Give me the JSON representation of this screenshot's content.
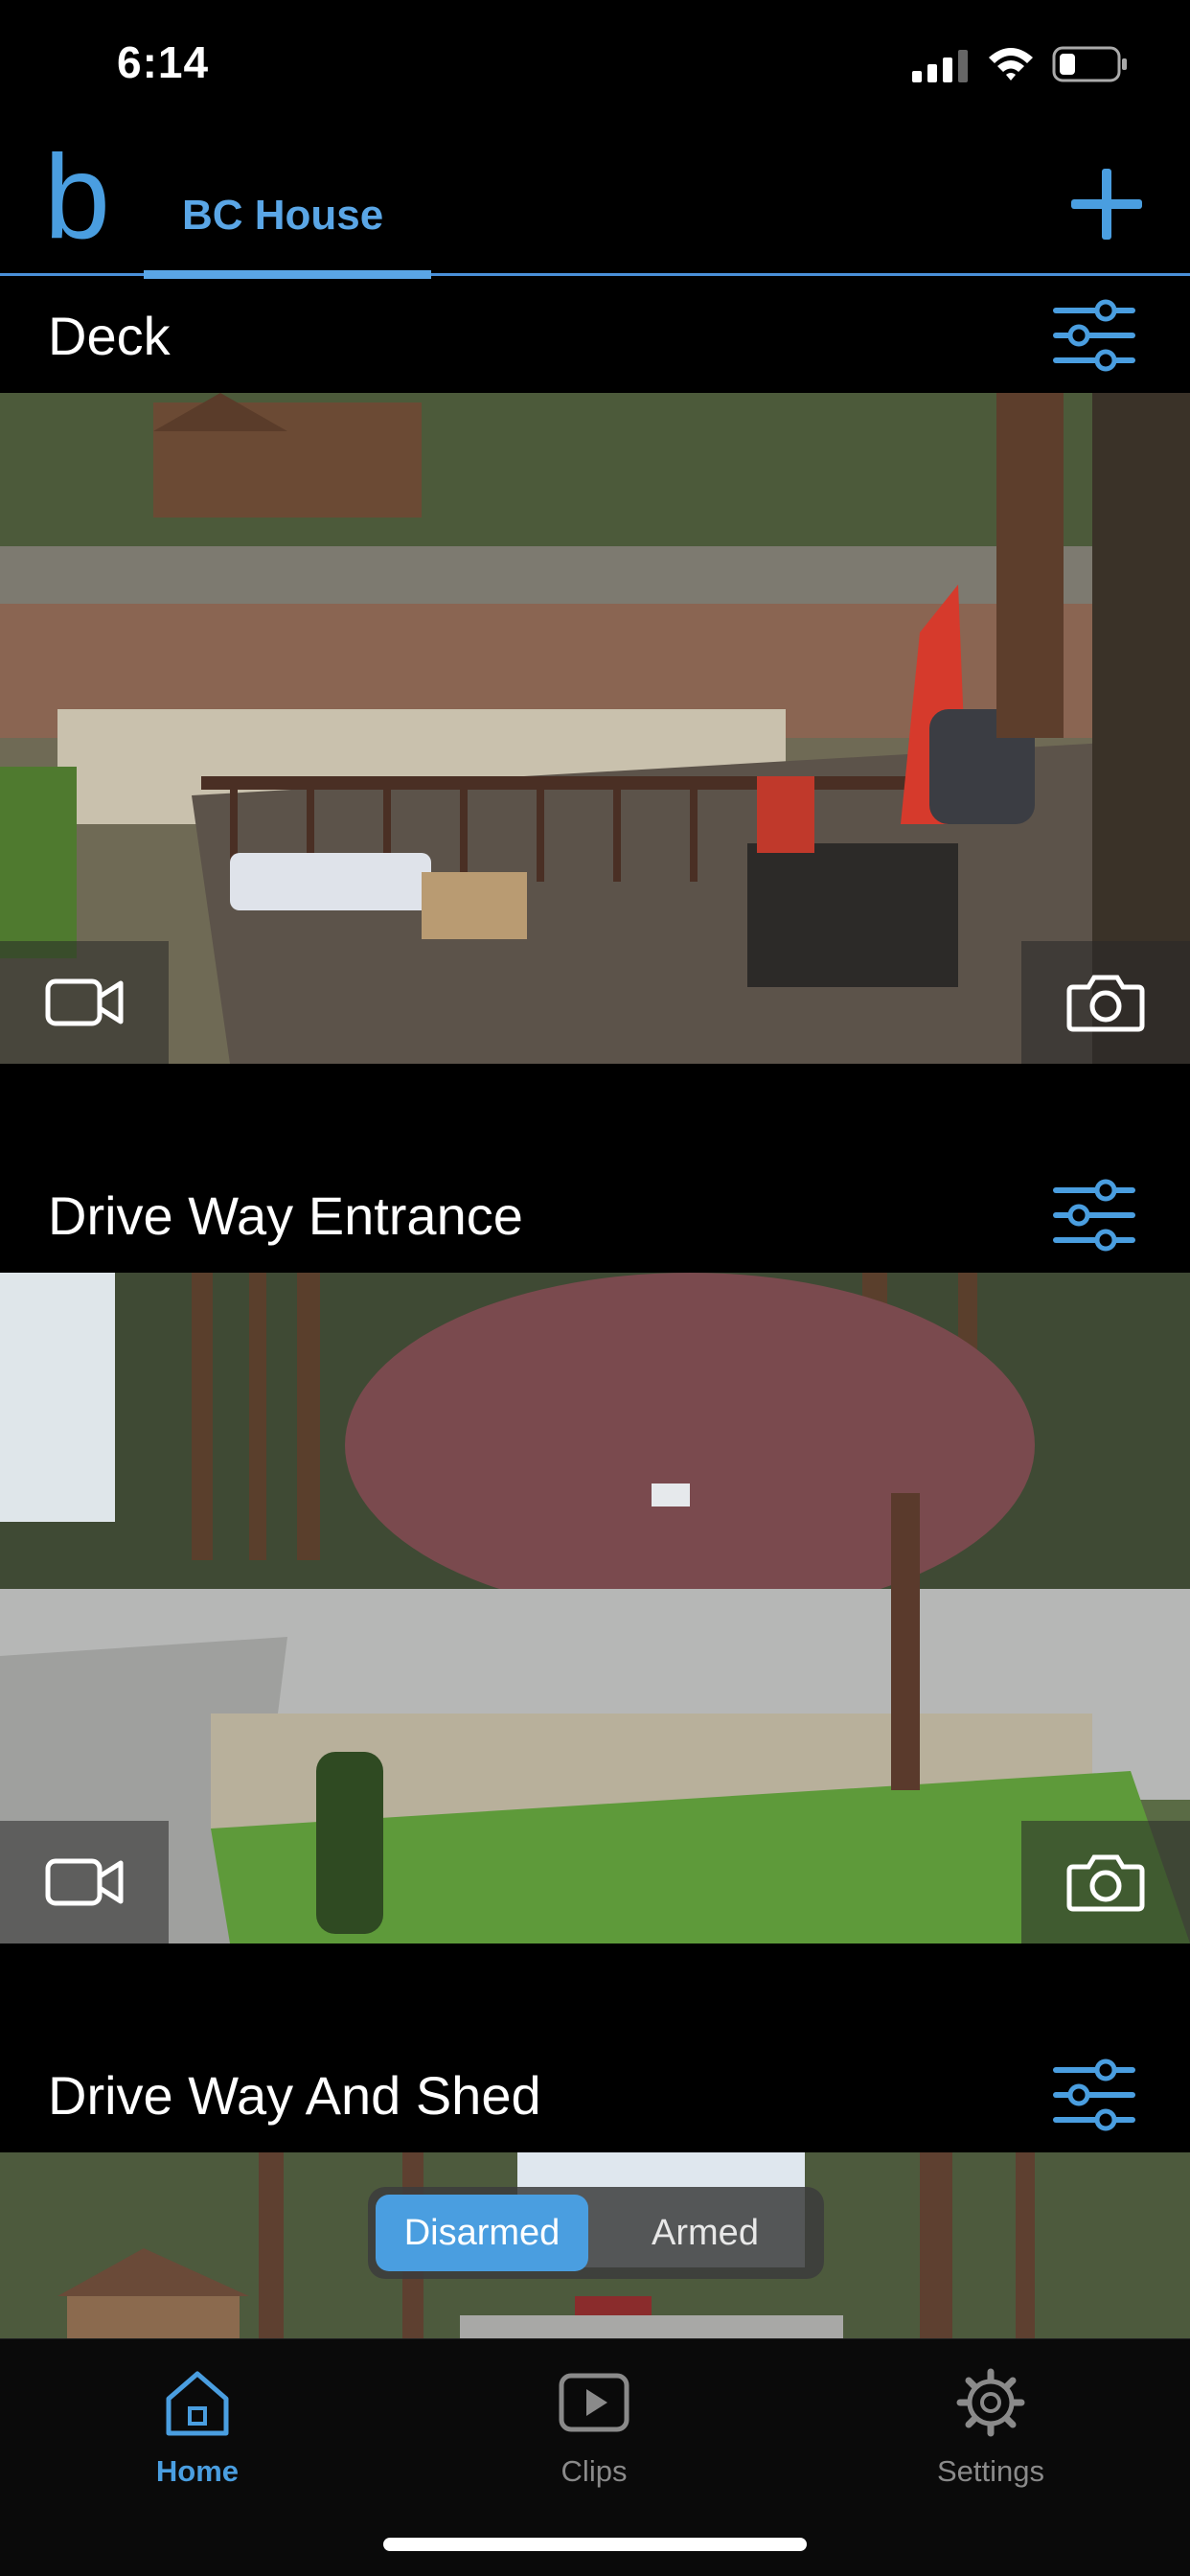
{
  "status_bar": {
    "time": "6:14"
  },
  "header": {
    "logo": "b",
    "location": "BC House",
    "add_icon": "plus-icon"
  },
  "cameras": [
    {
      "name": "Deck",
      "settings_icon": "sliders-icon",
      "record_icon": "video-camera-icon",
      "snapshot_icon": "camera-icon"
    },
    {
      "name": "Drive Way Entrance",
      "settings_icon": "sliders-icon",
      "record_icon": "video-camera-icon",
      "snapshot_icon": "camera-icon"
    },
    {
      "name": "Drive Way And Shed",
      "settings_icon": "sliders-icon"
    }
  ],
  "arm_toggle": {
    "options": [
      "Disarmed",
      "Armed"
    ],
    "selected": "Disarmed"
  },
  "tab_bar": {
    "tabs": [
      {
        "label": "Home",
        "icon": "home-icon",
        "active": true
      },
      {
        "label": "Clips",
        "icon": "play-icon",
        "active": false
      },
      {
        "label": "Settings",
        "icon": "gear-icon",
        "active": false
      }
    ]
  },
  "colors": {
    "accent": "#4a9ee0",
    "background": "#000000",
    "inactive": "#8a8a8a"
  }
}
